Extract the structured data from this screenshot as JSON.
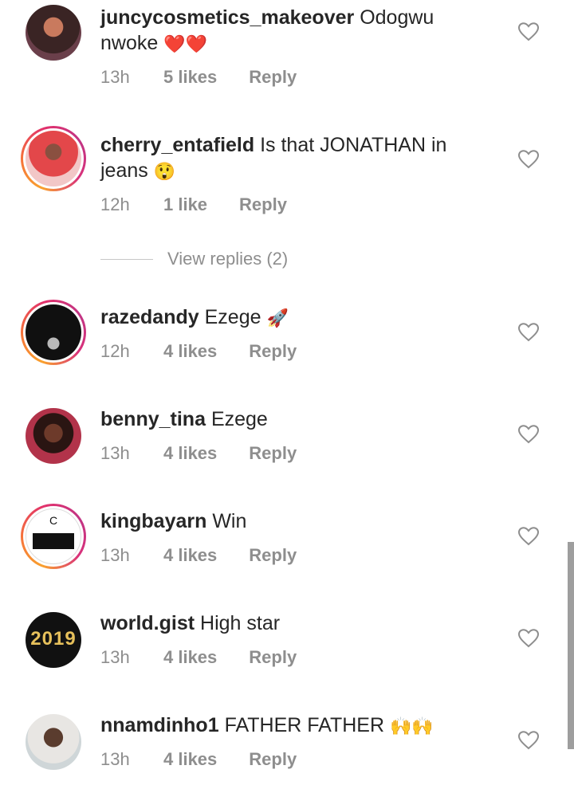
{
  "comments": [
    {
      "username": "juncycosmetics_makeover",
      "text": "Odogwu nwoke",
      "emoji": "❤️❤️",
      "time": "13h",
      "likes": "5 likes",
      "reply": "Reply"
    },
    {
      "username": "cherry_entafield",
      "text": "Is that JONATHAN in jeans",
      "emoji": "😲",
      "time": "12h",
      "likes": "1 like",
      "reply": "Reply",
      "view_replies": "View replies (2)"
    },
    {
      "username": "razedandy",
      "text": "Ezege",
      "emoji": "🚀",
      "time": "12h",
      "likes": "4 likes",
      "reply": "Reply"
    },
    {
      "username": "benny_tina",
      "text": "Ezege",
      "time": "13h",
      "likes": "4 likes",
      "reply": "Reply"
    },
    {
      "username": "kingbayarn",
      "text": "Win",
      "time": "13h",
      "likes": "4 likes",
      "reply": "Reply"
    },
    {
      "username": "world.gist",
      "text": "High star",
      "time": "13h",
      "likes": "4 likes",
      "reply": "Reply",
      "avatar_text": "2019"
    },
    {
      "username": "nnamdinho1",
      "text": "FATHER FATHER",
      "emoji": "🙌🙌",
      "time": "13h",
      "likes": "4 likes",
      "reply": "Reply"
    }
  ],
  "icons": {
    "like": "heart-outline-icon"
  },
  "colors": {
    "text": "#262626",
    "meta": "#8e8e8e",
    "story_ring_start": "#f9a12e",
    "story_ring_end": "#c13584"
  }
}
